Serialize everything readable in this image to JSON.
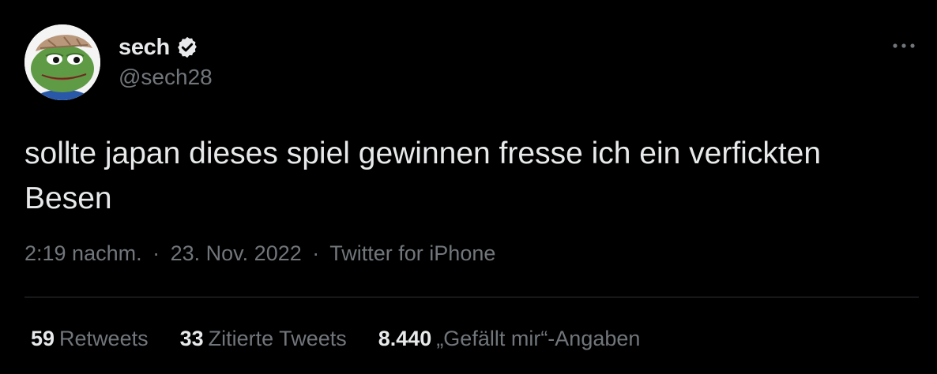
{
  "author": {
    "display_name": "sech",
    "handle": "@sech28",
    "verified": true,
    "avatar_icon": "frog-avatar"
  },
  "tweet": {
    "text": "sollte japan dieses spiel gewinnen fresse ich ein verfickten Besen",
    "time": "2:19 nachm.",
    "date": "23. Nov. 2022",
    "source": "Twitter for iPhone",
    "separator": "·"
  },
  "stats": {
    "retweets": {
      "count": "59",
      "label": "Retweets"
    },
    "quotes": {
      "count": "33",
      "label": "Zitierte Tweets"
    },
    "likes": {
      "count": "8.440",
      "label": "„Gefällt mir“-Angaben"
    }
  },
  "colors": {
    "background": "#000000",
    "primary_text": "#e7e9ea",
    "secondary_text": "#71767b",
    "divider": "#2f3336"
  }
}
